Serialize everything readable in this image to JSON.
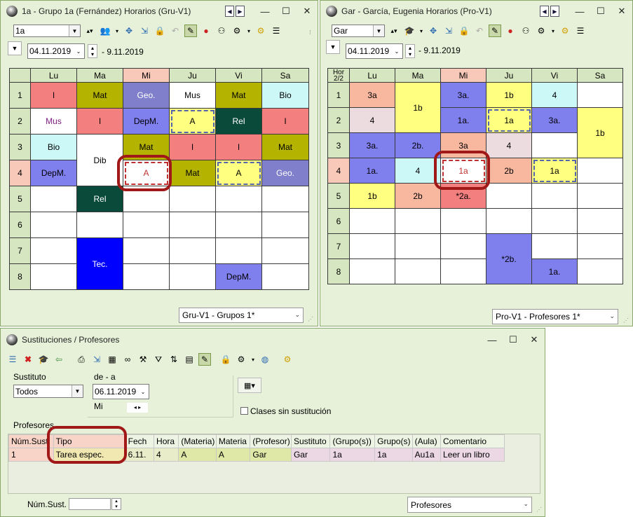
{
  "win1": {
    "title": "1a - Grupo 1a (Fernández)  Horarios  (Gru-V1)",
    "selector": "1a",
    "date_from": "04.11.2019",
    "date_to": "- 9.11.2019",
    "status_combo": "Gru-V1 - Grupos 1*",
    "days": [
      "Lu",
      "Ma",
      "Mi",
      "Ju",
      "Vi",
      "Sa"
    ],
    "rows": [
      "1",
      "2",
      "3",
      "4",
      "5",
      "6",
      "7",
      "8"
    ],
    "cells": {
      "r1": [
        "I",
        "Mat",
        "Geo.",
        "Mus",
        "Mat",
        "Bio"
      ],
      "r2": [
        "Mus",
        "I",
        "DepM.",
        "A",
        "Rel",
        "I"
      ],
      "r3": [
        "Bio",
        "Dib",
        "Mat",
        "I",
        "I",
        "Mat"
      ],
      "r4": [
        "DepM.",
        "A",
        "Mat",
        "A",
        "Geo."
      ],
      "r5": [
        "Rel"
      ],
      "r7": [
        "Tec.",
        "DepM."
      ]
    }
  },
  "win2": {
    "title": "Gar - García, Eugenia  Horarios  (Pro-V1)",
    "selector": "Gar",
    "date_from": "04.11.2019",
    "date_to": "- 9.11.2019",
    "status_combo": "Pro-V1 - Profesores 1*",
    "corner_top": "Hor",
    "corner_bottom": "2/2",
    "days": [
      "Lu",
      "Ma",
      "Mi",
      "Ju",
      "Vi",
      "Sa"
    ],
    "rows": [
      "1",
      "2",
      "3",
      "4",
      "5",
      "6",
      "7",
      "8"
    ],
    "cells": {
      "r1": [
        "3a",
        "1b",
        "3a.",
        "1b",
        "4"
      ],
      "r2": [
        "4",
        "1a.",
        "1a",
        "3a.",
        "1b"
      ],
      "r3": [
        "3a.",
        "2b.",
        "3a",
        "4"
      ],
      "r4": [
        "1a.",
        "4",
        "1a",
        "2b",
        "1a"
      ],
      "r5": [
        "1b",
        "2b",
        "*2a."
      ],
      "r7": [
        "*2b."
      ],
      "r8": [
        "1a."
      ]
    }
  },
  "win3": {
    "title": "Sustituciones / Profesores",
    "sustituto_label": "Sustituto",
    "sustituto_value": "Todos",
    "de_a_label": "de - a",
    "date": "06.11.2019",
    "weekday": "Mi",
    "checkbox_label": "Clases sin sustitución",
    "section_label": "Profesores",
    "columns": [
      "Núm.Sust",
      "Tipo",
      "Fech",
      "Hora",
      "(Materia)",
      "Materia",
      "(Profesor)",
      "Sustituto",
      "(Grupo(s))",
      "Grupo(s)",
      "(Aula)",
      "Comentario"
    ],
    "row": [
      "1",
      "Tarea espec.",
      "6.11.",
      "4",
      "A",
      "A",
      "Gar",
      "Gar",
      "1a",
      "1a",
      "Au1a",
      "Leer un libro"
    ],
    "num_sust_label": "Núm.Sust.",
    "bottom_combo": "Profesores"
  },
  "colors": {
    "window_bg": "#e7f0d8",
    "header_green": "#d6e6c0",
    "header_today": "#f8c8b8",
    "highlight_red": "#a01818"
  }
}
